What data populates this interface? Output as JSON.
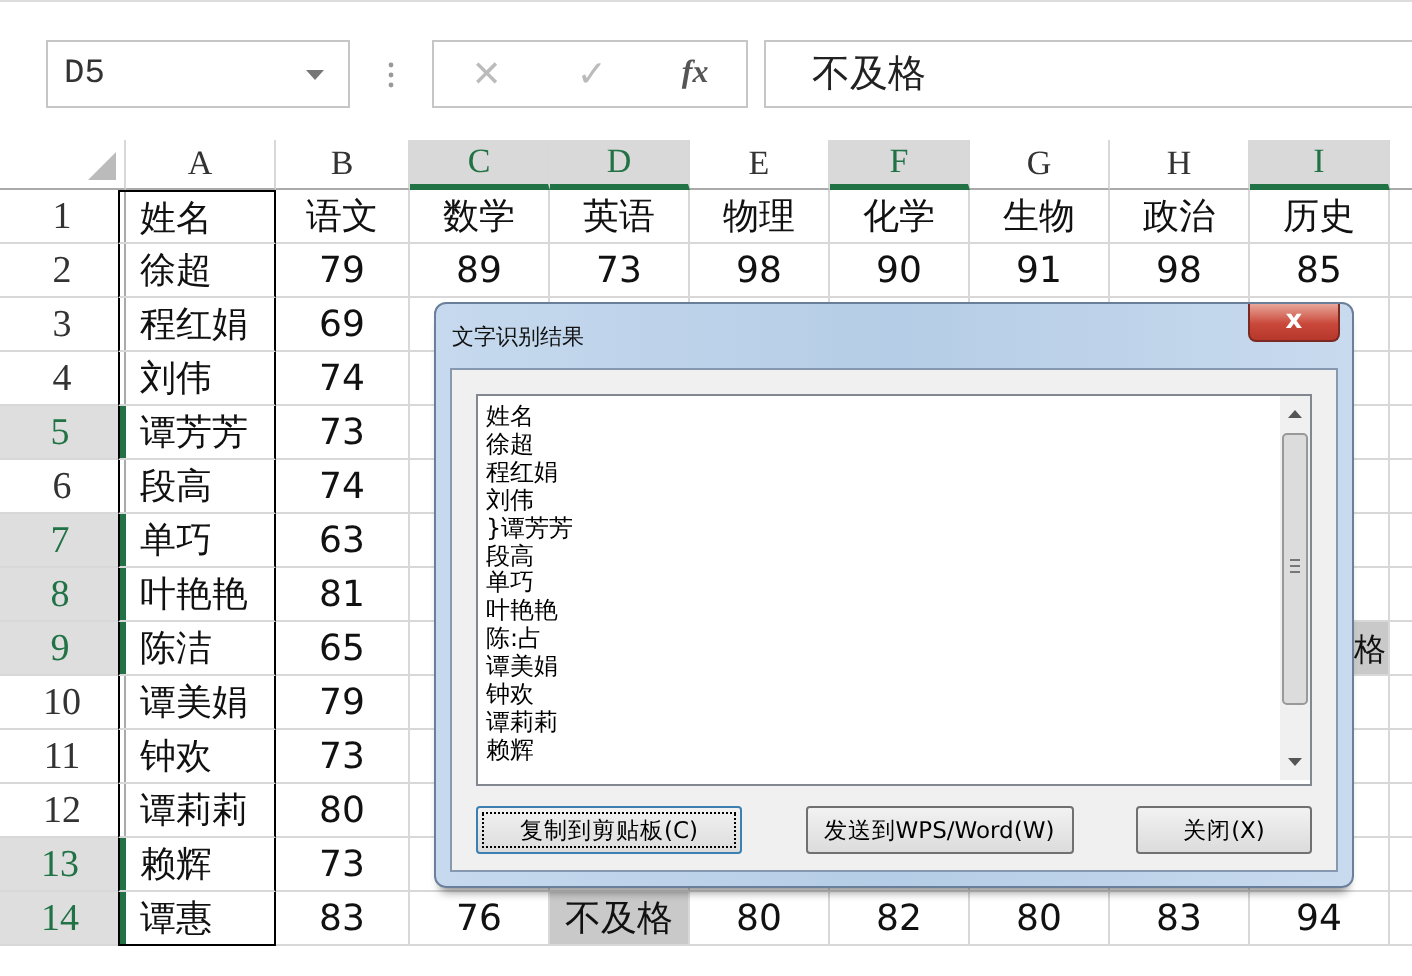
{
  "formula_bar": {
    "name_box": "D5",
    "cancel": "✕",
    "enter": "✓",
    "function": "fx",
    "value": "不及格"
  },
  "columns": [
    {
      "label": "A",
      "selected": false
    },
    {
      "label": "B",
      "selected": false
    },
    {
      "label": "C",
      "selected": true
    },
    {
      "label": "D",
      "selected": true
    },
    {
      "label": "E",
      "selected": false
    },
    {
      "label": "F",
      "selected": true
    },
    {
      "label": "G",
      "selected": false
    },
    {
      "label": "H",
      "selected": false
    },
    {
      "label": "I",
      "selected": true
    }
  ],
  "rows": [
    {
      "header": "1",
      "selected": false,
      "cells": [
        {
          "text": "姓名",
          "highlighted": false
        },
        {
          "text": "语文",
          "highlighted": false
        },
        {
          "text": "数学",
          "highlighted": false
        },
        {
          "text": "英语",
          "highlighted": false
        },
        {
          "text": "物理",
          "highlighted": false
        },
        {
          "text": "化学",
          "highlighted": false
        },
        {
          "text": "生物",
          "highlighted": false
        },
        {
          "text": "政治",
          "highlighted": false
        },
        {
          "text": "历史",
          "highlighted": false
        }
      ]
    },
    {
      "header": "2",
      "selected": false,
      "cells": [
        {
          "text": "徐超",
          "highlighted": false
        },
        {
          "text": "79",
          "highlighted": false
        },
        {
          "text": "89",
          "highlighted": false
        },
        {
          "text": "73",
          "highlighted": false
        },
        {
          "text": "98",
          "highlighted": false
        },
        {
          "text": "90",
          "highlighted": false
        },
        {
          "text": "91",
          "highlighted": false
        },
        {
          "text": "98",
          "highlighted": false
        },
        {
          "text": "85",
          "highlighted": false
        }
      ]
    },
    {
      "header": "3",
      "selected": false,
      "cells": [
        {
          "text": "程红娟",
          "highlighted": false
        },
        {
          "text": "69",
          "highlighted": false
        }
      ]
    },
    {
      "header": "4",
      "selected": false,
      "cells": [
        {
          "text": "刘伟",
          "highlighted": false
        },
        {
          "text": "74",
          "highlighted": false
        }
      ]
    },
    {
      "header": "5",
      "selected": true,
      "cells": [
        {
          "text": "谭芳芳",
          "highlighted": false
        },
        {
          "text": "73",
          "highlighted": false
        }
      ]
    },
    {
      "header": "6",
      "selected": false,
      "cells": [
        {
          "text": "段高",
          "highlighted": false
        },
        {
          "text": "74",
          "highlighted": false
        }
      ]
    },
    {
      "header": "7",
      "selected": true,
      "cells": [
        {
          "text": "单巧",
          "highlighted": false
        },
        {
          "text": "63",
          "highlighted": false
        }
      ]
    },
    {
      "header": "8",
      "selected": true,
      "cells": [
        {
          "text": "叶艳艳",
          "highlighted": false
        },
        {
          "text": "81",
          "highlighted": false
        }
      ]
    },
    {
      "header": "9",
      "selected": true,
      "cells": [
        {
          "text": "陈洁",
          "highlighted": false
        },
        {
          "text": "65",
          "highlighted": false
        }
      ],
      "edge_cell": {
        "text": "格",
        "highlighted": true
      }
    },
    {
      "header": "10",
      "selected": false,
      "cells": [
        {
          "text": "谭美娟",
          "highlighted": false
        },
        {
          "text": "79",
          "highlighted": false
        }
      ]
    },
    {
      "header": "11",
      "selected": false,
      "cells": [
        {
          "text": "钟欢",
          "highlighted": false
        },
        {
          "text": "73",
          "highlighted": false
        }
      ]
    },
    {
      "header": "12",
      "selected": false,
      "cells": [
        {
          "text": "谭莉莉",
          "highlighted": false
        },
        {
          "text": "80",
          "highlighted": false
        }
      ]
    },
    {
      "header": "13",
      "selected": true,
      "cells": [
        {
          "text": "赖辉",
          "highlighted": false
        },
        {
          "text": "73",
          "highlighted": false
        }
      ]
    },
    {
      "header": "14",
      "selected": true,
      "cells": [
        {
          "text": "谭惠",
          "highlighted": false
        },
        {
          "text": "83",
          "highlighted": false
        },
        {
          "text": "76",
          "highlighted": false
        },
        {
          "text": "不及格",
          "highlighted": true
        },
        {
          "text": "80",
          "highlighted": false
        },
        {
          "text": "82",
          "highlighted": false
        },
        {
          "text": "80",
          "highlighted": false
        },
        {
          "text": "83",
          "highlighted": false
        },
        {
          "text": "94",
          "highlighted": false
        }
      ]
    }
  ],
  "dialog": {
    "title": "文字识别结果",
    "close": "x",
    "result_lines": [
      "姓名",
      "徐超",
      "程红娟",
      "刘伟",
      "}谭芳芳",
      "段高",
      "单巧",
      "叶艳艳",
      "陈:占",
      "谭美娟",
      "钟欢",
      "谭莉莉",
      "赖辉"
    ],
    "buttons": [
      {
        "label": "复制到剪贴板(C)",
        "focused": true
      },
      {
        "label": "发送到WPS/Word(W)",
        "focused": false
      },
      {
        "label": "关闭(X)",
        "focused": false
      }
    ]
  }
}
